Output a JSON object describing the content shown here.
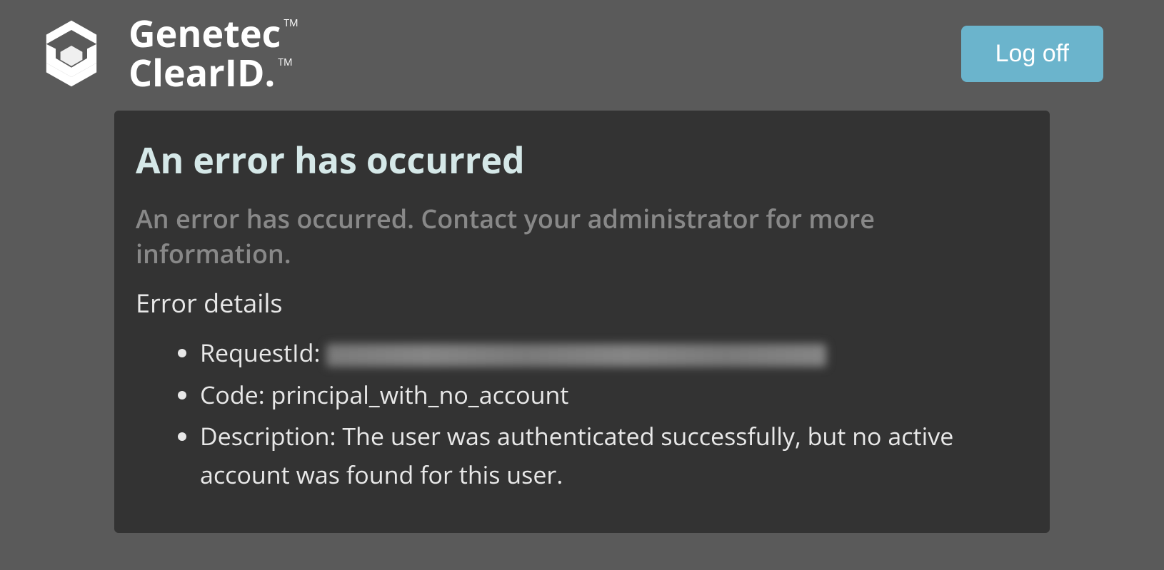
{
  "header": {
    "logo": {
      "line1": "Genetec",
      "line2": "ClearID.",
      "tm": "TM"
    },
    "logoff_label": "Log off"
  },
  "error": {
    "title": "An error has occurred",
    "subtitle": "An error has occurred. Contact your administrator for more information.",
    "details_heading": "Error details",
    "request_id_label": "RequestId: ",
    "code_label": "Code: ",
    "code_value": "principal_with_no_account",
    "description_label": "Description: ",
    "description_value": "The user was authenticated successfully, but no active account was found for this user."
  }
}
